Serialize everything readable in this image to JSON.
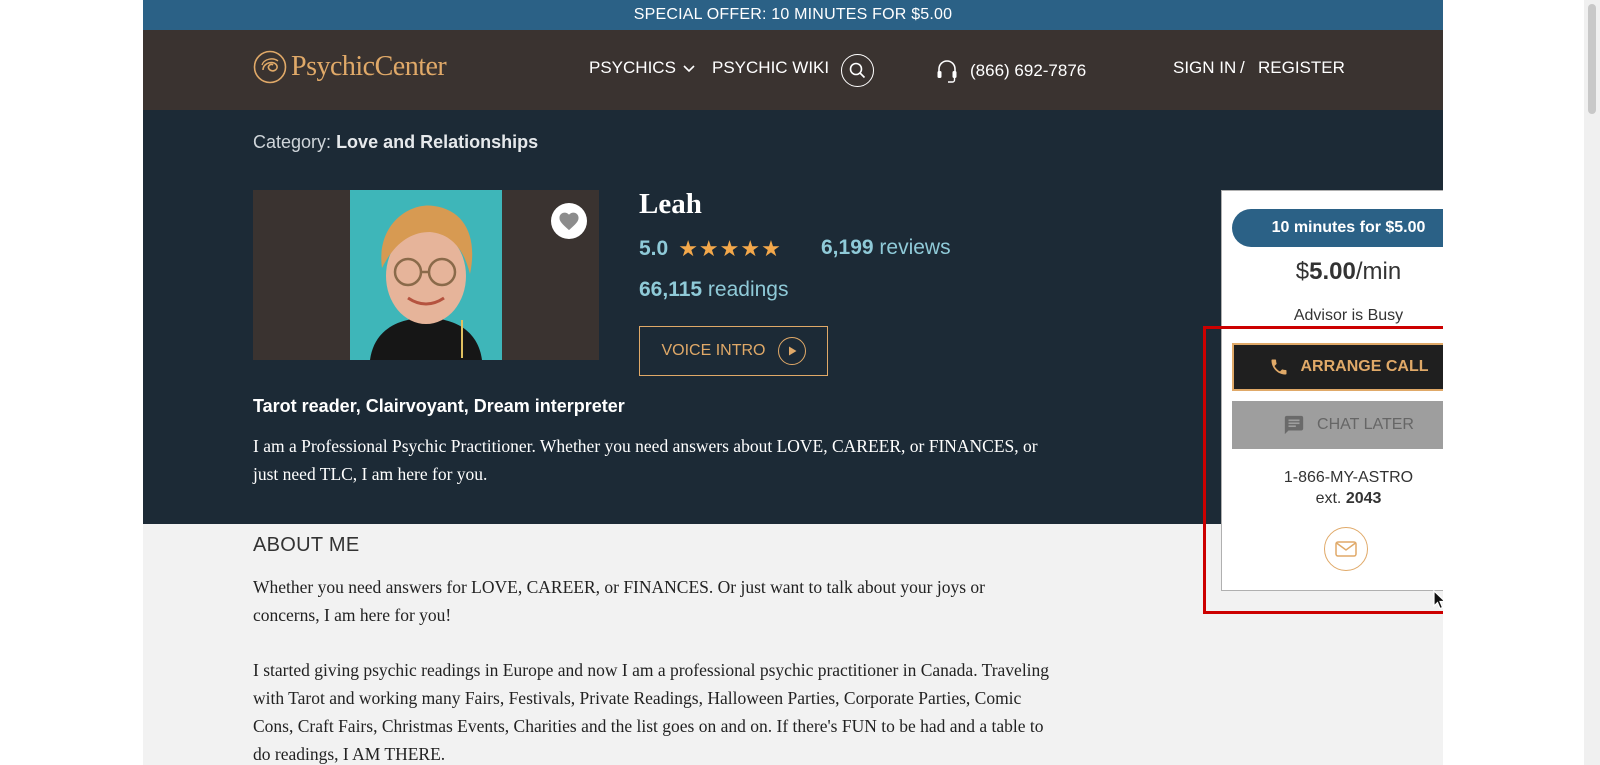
{
  "offer_bar": "SPECIAL OFFER: 10 MINUTES FOR $5.00",
  "nav": {
    "logo": "PsychicCenter",
    "psychics": "PSYCHICS",
    "wiki": "PSYCHIC WIKI",
    "phone": "(866) 692-7876",
    "sign_in": "SIGN IN",
    "slash": "/",
    "register": "REGISTER"
  },
  "profile": {
    "category_label": "Category:",
    "category": "Love and Relationships",
    "name": "Leah",
    "rating": "5.0",
    "stars": "★★★★★",
    "rating_value": 5,
    "reviews_count": "6,199",
    "reviews_label": "reviews",
    "readings_count": "66,115",
    "readings_label": "readings",
    "voice_intro": "VOICE INTRO",
    "specialties": "Tarot reader, Clairvoyant, Dream interpreter",
    "intro": "I am a Professional Psychic Practitioner. Whether you need answers about LOVE, CAREER, or FINANCES, or just need TLC, I am here for you."
  },
  "about": {
    "title": "ABOUT ME",
    "paragraphs": [
      "Whether you need answers for LOVE, CAREER, or FINANCES. Or just want to talk about your joys or concerns, I am here for you!",
      "I started giving psychic readings in Europe and now I am a professional psychic practitioner in Canada. Traveling with Tarot and working many Fairs, Festivals, Private Readings, Halloween Parties, Corporate Parties, Comic Cons, Craft Fairs, Christmas Events, Charities and the list goes on and on. If there's FUN to be had and a table to do readings, I AM THERE."
    ]
  },
  "card": {
    "offer": "10 minutes for $5.00",
    "rate_currency": "$",
    "rate_value": "5.00",
    "rate_unit": "/min",
    "status": "Advisor is Busy",
    "arrange_call": "ARRANGE CALL",
    "chat_later": "CHAT LATER",
    "phone": "1-866-MY-ASTRO",
    "ext_label": "ext.",
    "ext": "2043"
  },
  "colors": {
    "accent_gold": "#e0a968",
    "offer_blue": "#2b6186",
    "nav_bg": "#3a3330",
    "hero_bg": "#1c2a36",
    "highlight_red": "#cc0000"
  },
  "icons": [
    "logo-mark-icon",
    "chevron-down-icon",
    "search-icon",
    "headset-icon",
    "heart-icon",
    "star-icon",
    "play-icon",
    "phone-icon",
    "chat-icon",
    "mail-icon",
    "cursor-icon"
  ]
}
